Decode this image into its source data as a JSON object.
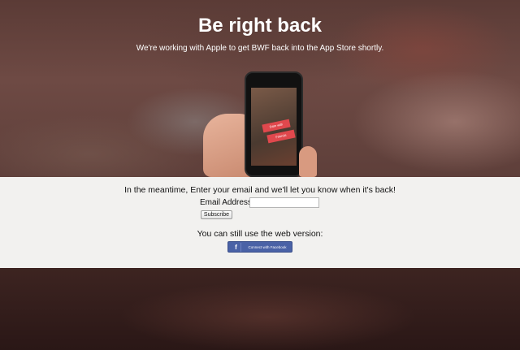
{
  "header": {
    "title": "Be right back",
    "subtitle": "We're working with Apple to get BWF back into the App Store shortly."
  },
  "phone": {
    "ribbon_top": "Date with",
    "ribbon_bottom": "Friends"
  },
  "signup": {
    "intro_text": "In the meantime, Enter your email and we'll let you know when it's back!",
    "email_label": "Email Address",
    "email_value": "",
    "subscribe_label": "Subscribe"
  },
  "web": {
    "text": "You can still use the web version:",
    "facebook_icon": "f",
    "facebook_label": "Connect with Facebook"
  },
  "colors": {
    "facebook_blue": "#4a62a6",
    "ribbon_red": "#e0484d",
    "panel_bg": "#f2f1ef"
  }
}
